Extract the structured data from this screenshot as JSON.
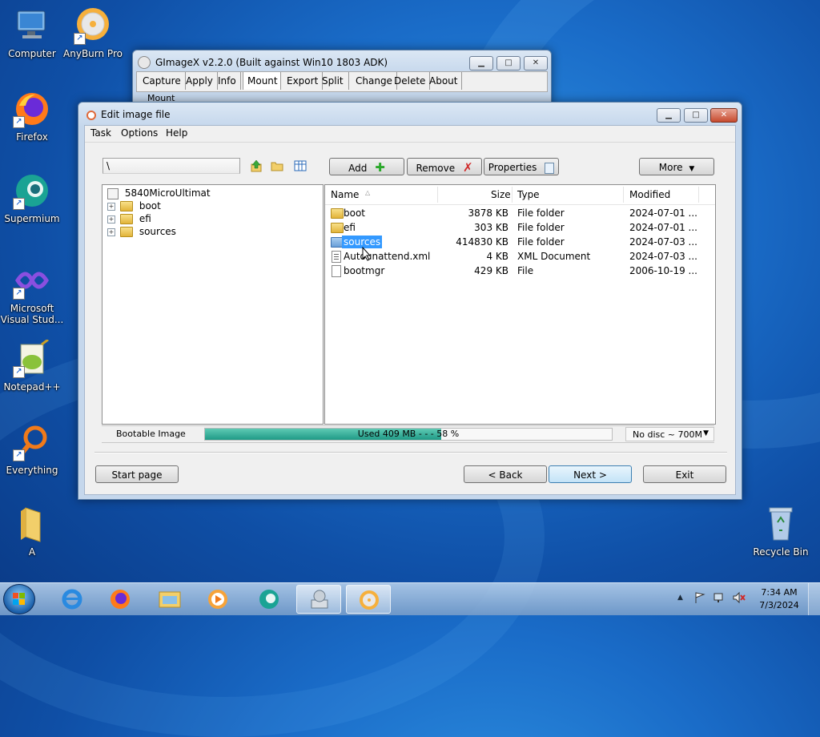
{
  "desktop": {
    "icons": [
      {
        "label": "Computer"
      },
      {
        "label": "AnyBurn Pro"
      },
      {
        "label": "Firefox"
      },
      {
        "label": "Supermium"
      },
      {
        "label": "Microsoft Visual Stud..."
      },
      {
        "label": "Notepad++"
      },
      {
        "label": "Everything"
      },
      {
        "label": "A"
      },
      {
        "label": "Recycle Bin"
      }
    ]
  },
  "gimagex": {
    "title": "GImageX v2.2.0 (Built against Win10 1803 ADK)",
    "tabs": [
      "Capture",
      "Apply",
      "Info",
      "Mount",
      "Export",
      "Split",
      "Change",
      "Delete",
      "About"
    ],
    "active_tab": "Mount",
    "sub_label": "Mount"
  },
  "editor": {
    "title": "Edit image file",
    "menu": [
      "Task",
      "Options",
      "Help"
    ],
    "path_value": "\\",
    "toolbar": {
      "add": "Add",
      "remove": "Remove",
      "properties": "Properties",
      "more": "More"
    },
    "tree": {
      "root": "5840MicroUltimat",
      "children": [
        "boot",
        "efi",
        "sources"
      ]
    },
    "columns": {
      "name": "Name",
      "size": "Size",
      "type": "Type",
      "modified": "Modified"
    },
    "files": [
      {
        "name": "boot",
        "size": "3878 KB",
        "type": "File folder",
        "modified": "2024-07-01 ...",
        "icon": "folder-icon"
      },
      {
        "name": "efi",
        "size": "303 KB",
        "type": "File folder",
        "modified": "2024-07-01 ...",
        "icon": "folder-icon"
      },
      {
        "name": "sources",
        "size": "414830 KB",
        "type": "File folder",
        "modified": "2024-07-03 ...",
        "icon": "folder-icon"
      },
      {
        "name": "Autounattend.xml",
        "size": "4 KB",
        "type": "XML Document",
        "modified": "2024-07-03 ...",
        "icon": "xml-file-icon"
      },
      {
        "name": "bootmgr",
        "size": "429 KB",
        "type": "File",
        "modified": "2006-10-19 ...",
        "icon": "file-icon"
      }
    ],
    "status": {
      "bootable": "Bootable Image",
      "used_label": "Used  409 MB  - - -  58 %",
      "used_fraction": 0.58,
      "disc": "No disc ~ 700M"
    },
    "footer": {
      "start": "Start page",
      "back": "< Back",
      "next": "Next >",
      "exit": "Exit"
    }
  },
  "taskbar": {
    "clock_time": "7:34 AM",
    "clock_date": "7/3/2024"
  },
  "colors": {
    "progress": "#2aa38f",
    "selection": "#3399ff"
  }
}
